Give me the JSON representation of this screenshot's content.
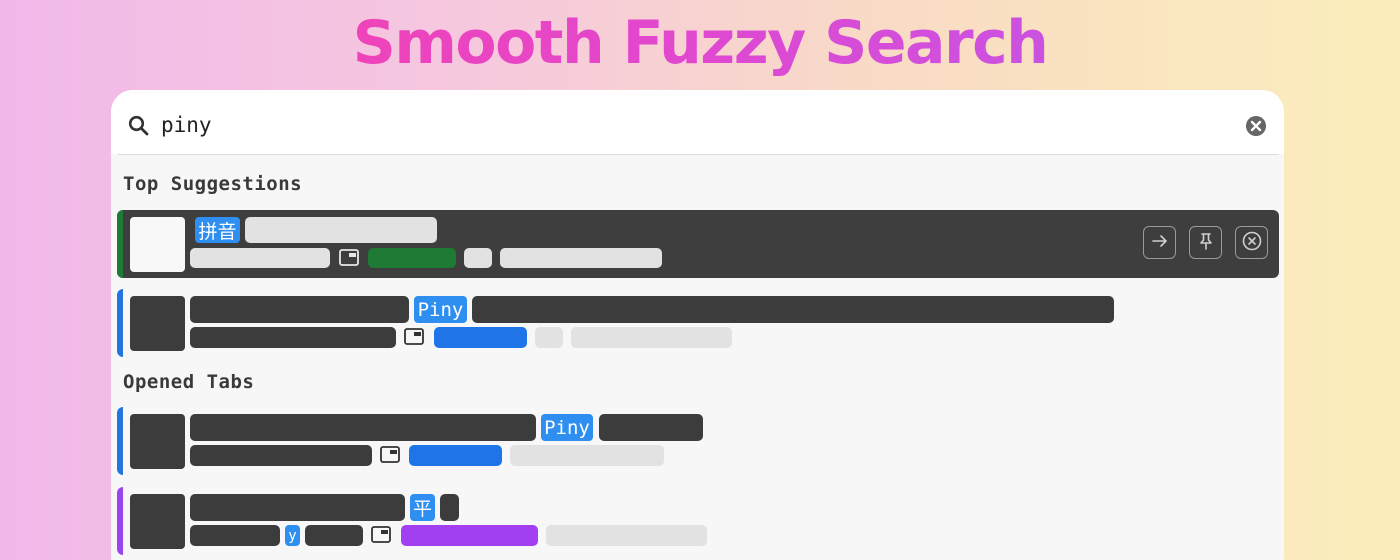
{
  "hero": {
    "title": "Smooth Fuzzy Search"
  },
  "search": {
    "query": "piny"
  },
  "sections": {
    "top_suggestions": "Top Suggestions",
    "opened_tabs": "Opened Tabs"
  },
  "results": [
    {
      "section": "Top Suggestions",
      "selected": true,
      "match_tag": "拼音",
      "accent_color": "#1f7a36",
      "badge_color": "#1f7a36"
    },
    {
      "section": "Top Suggestions",
      "selected": false,
      "match_tag": "Piny",
      "accent_color": "#2474e0",
      "badge_color": "#1f74e8"
    },
    {
      "section": "Opened Tabs",
      "selected": false,
      "match_tag": "Piny",
      "accent_color": "#2474e0",
      "badge_color": "#1f74e8"
    },
    {
      "section": "Opened Tabs",
      "selected": false,
      "match_tag": "平",
      "sub_tag": "y",
      "accent_color": "#9b45ee",
      "badge_color": "#a23ff0"
    }
  ],
  "icons": {
    "search": "search-icon",
    "clear": "clear-icon",
    "window": "window-icon",
    "actions": [
      "arrow-right-icon",
      "pin-icon",
      "close-circle-icon"
    ]
  },
  "colors": {
    "title_gradient": [
      "#ff3ea2",
      "#b55cf2"
    ],
    "selected_row_bg": "#3e3e3e",
    "redaction_dark": "#3c3c3c",
    "redaction_light": "#e2e2e2",
    "match_tag_bg": "#2f8ff0"
  }
}
